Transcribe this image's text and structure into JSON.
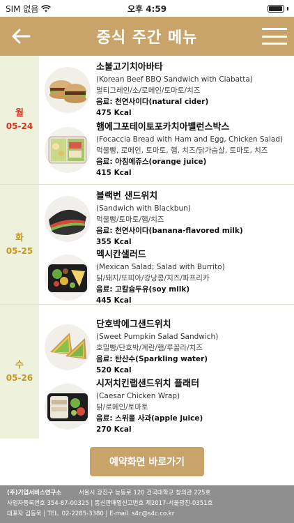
{
  "status_bar": {
    "carrier": "SIM 없음",
    "time": "오후 4:59",
    "battery_level": 0.95
  },
  "header": {
    "title": "중식 주간 메뉴"
  },
  "colors": {
    "brand": "#c8a46a",
    "day_bg": "#eef1dc",
    "day_red": "#d7321e",
    "day_amber": "#c8961e",
    "footer_bg": "#8f8f8f"
  },
  "days": [
    {
      "day": "월",
      "date": "05-24",
      "color": "#d7321e",
      "items": [
        {
          "name_ko": "소불고기치아바타",
          "name_en": "(Korean Beef BBQ Sandwich with Ciabatta)",
          "ingredients": "멀티그레인/소/로메인/토마토/치즈",
          "drink": "음료: 천연사이다(natural cider)",
          "kcal": "475 Kcal",
          "icon": "ciabatta-sandwich"
        },
        {
          "name_ko": "햄에그포테이토포카치아밸런스박스",
          "name_en": "(Focaccia Bread with Ham and Egg, Chicken Salad)",
          "ingredients": "먹물빵, 로메인, 토마토, 햄, 치즈/닭가슴살, 토마토, 치즈",
          "drink": "음료: 아침에쥬스(orange juice)",
          "kcal": "415 Kcal",
          "icon": "focaccia-box"
        }
      ]
    },
    {
      "day": "화",
      "date": "05-25",
      "color": "#c8961e",
      "items": [
        {
          "name_ko": "블랙번 샌드위치",
          "name_en": "(Sandwich with Blackbun)",
          "ingredients": "먹물빵/토마토/햄/치즈",
          "drink": "음료: 천연사이다(banana-flavored milk)",
          "kcal": "355 Kcal",
          "icon": "blackbun-sandwich"
        },
        {
          "name_ko": "멕시칸샐러드",
          "name_en": "(Mexican Salad; Salad with Burrito)",
          "ingredients": "닭/돼지/또띠아/강낭콩/치즈/파프리카",
          "drink": "음료: 고칼슘두유(soy milk)",
          "kcal": "445 Kcal",
          "icon": "mexican-salad"
        }
      ]
    },
    {
      "day": "수",
      "date": "05-26",
      "color": "#c8961e",
      "items": [
        {
          "name_ko": "단호박에그샌드위치",
          "name_en": "(Sweet Pumpkin Salad Sandwich)",
          "ingredients": "호밀빵/단호박/계란/햄/루꼴라/치즈",
          "drink": "음료: 탄산수(Sparkling water)",
          "kcal": "520 Kcal",
          "icon": "pumpkin-sandwich"
        },
        {
          "name_ko": "시저치킨랩샌드위치 플래터",
          "name_en": "(Caesar Chicken Wrap)",
          "ingredients": "닭/로메인/토마토",
          "drink": "음료: 스위몰 사과(apple juice)",
          "kcal": "270 Kcal",
          "icon": "chicken-wrap-platter"
        }
      ]
    }
  ],
  "reserve_button": "예약화면 바로가기",
  "footer": {
    "company": "(주)기업서비스연구소",
    "address": "서울시 광진구 능동로 120 건국대학교 창의관 225호",
    "line2": "사업자등록번호 354-87-00325 | 통신판매업신고번호 제2017-서울광진-0351호",
    "line3": "대표자 김동욱 | TEL. 02-2285-3380 | E-mail. s4c@s4c.co.kr"
  }
}
